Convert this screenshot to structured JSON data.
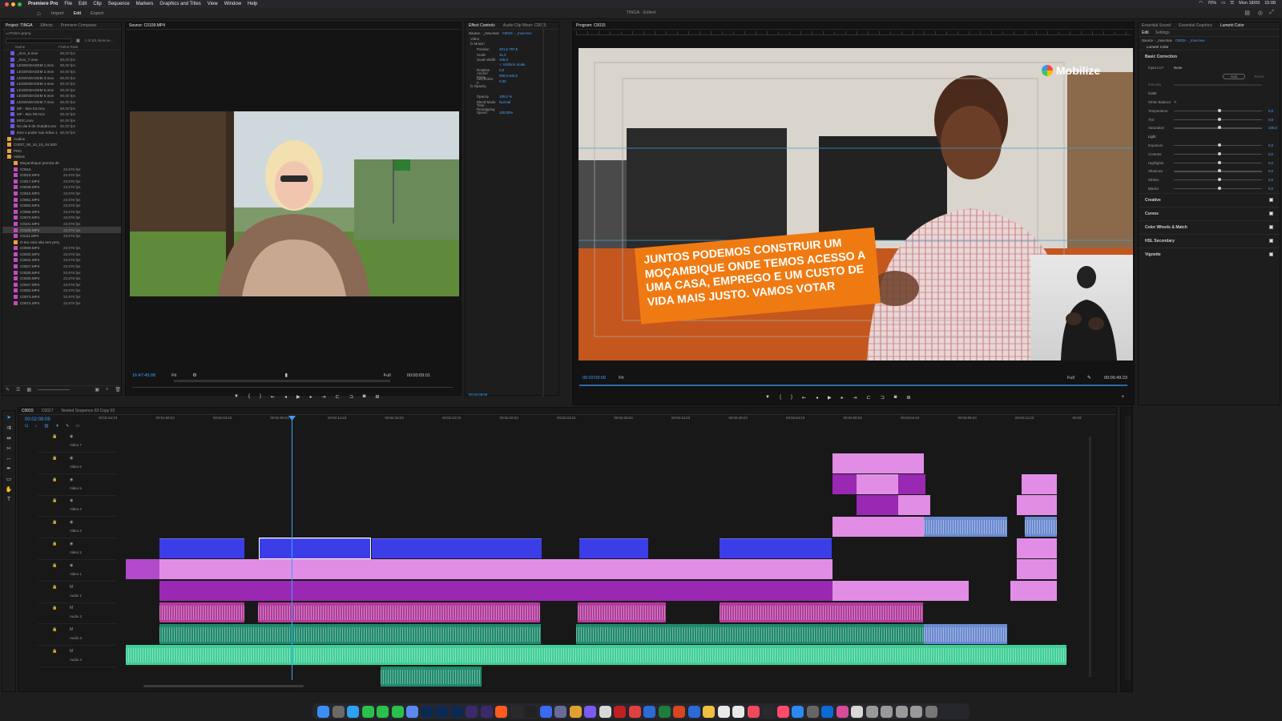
{
  "menubar": {
    "app": "Premiere Pro",
    "items": [
      "File",
      "Edit",
      "Clip",
      "Sequence",
      "Markers",
      "Graphics and Titles",
      "View",
      "Window",
      "Help"
    ],
    "right_status": [
      "70%",
      "Mon 18/09",
      "15:08"
    ]
  },
  "workspace": {
    "tabs": [
      "Import",
      "Edit",
      "Export"
    ],
    "active": "Edit",
    "title": "TINGA - Edited"
  },
  "project": {
    "tabs": [
      "Project: TINGA",
      "Effects",
      "Premiere Composer"
    ],
    "file": "TINGA.prproj",
    "count": "1 of 101 items se...",
    "columns": [
      "Name",
      "Frame Rate"
    ],
    "items": [
      {
        "name": "_mov_6.mov",
        "rate": "60,00 fps",
        "color": "#6b58e0"
      },
      {
        "name": "_mov_7.mov",
        "rate": "60,00 fps",
        "color": "#6b58e0"
      },
      {
        "name": "LEGENDAGEM 1.mov",
        "rate": "60,00 fps",
        "color": "#6b58e0"
      },
      {
        "name": "LEGENDAGEM 2.mov",
        "rate": "60,00 fps",
        "color": "#6b58e0"
      },
      {
        "name": "LEGENDAGEM 3.mov",
        "rate": "60,00 fps",
        "color": "#6b58e0"
      },
      {
        "name": "LEGENDAGEM 4.mov",
        "rate": "60,00 fps",
        "color": "#6b58e0"
      },
      {
        "name": "LEGENDAGEM 5.mov",
        "rate": "60,00 fps",
        "color": "#6b58e0"
      },
      {
        "name": "LEGENDAGEM 6.mov",
        "rate": "60,00 fps",
        "color": "#6b58e0"
      },
      {
        "name": "LEGENDAGEM 7.mov",
        "rate": "60,00 fps",
        "color": "#6b58e0"
      },
      {
        "name": "MF - Box 04.mov",
        "rate": "60,00 fps",
        "color": "#6b58e0"
      },
      {
        "name": "MF - Box 09.mov",
        "rate": "60,00 fps",
        "color": "#6b58e0"
      },
      {
        "name": "MOC.mov",
        "rate": "60,00 fps",
        "color": "#6b58e0"
      },
      {
        "name": "No dia 9 de Outubro.mo",
        "rate": "60,00 fps",
        "color": "#6b58e0"
      },
      {
        "name": "tens o poder nas mãos 1",
        "rate": "60,00 fps",
        "color": "#6b58e0"
      },
      {
        "name": "Audios",
        "rate": "",
        "color": "#e8a23a"
      },
      {
        "name": "C0037_00_10_15_04.S0093",
        "rate": "",
        "color": "#e8a23a"
      },
      {
        "name": "PNG",
        "rate": "",
        "color": "#e8a23a"
      },
      {
        "name": "Videos",
        "rate": "",
        "color": "#e8a23a"
      },
      {
        "name": "Moçambique precisa de",
        "rate": "",
        "color": "#e8a23a"
      },
      {
        "name": "C0016",
        "rate": "23,976 fps",
        "color": "#c44bc0"
      },
      {
        "name": "C0015.MP4",
        "rate": "23,976 fps",
        "color": "#c44bc0"
      },
      {
        "name": "C0017.MP4",
        "rate": "23,976 fps",
        "color": "#c44bc0"
      },
      {
        "name": "C0049.MP4",
        "rate": "23,976 fps",
        "color": "#c44bc0"
      },
      {
        "name": "C0016.MP4",
        "rate": "23,976 fps",
        "color": "#c44bc0"
      },
      {
        "name": "C0061.MP4",
        "rate": "23,976 fps",
        "color": "#c44bc0"
      },
      {
        "name": "C0063.MP4",
        "rate": "23,976 fps",
        "color": "#c44bc0"
      },
      {
        "name": "C0065.MP4",
        "rate": "23,976 fps",
        "color": "#c44bc0"
      },
      {
        "name": "C0070.MP4",
        "rate": "23,976 fps",
        "color": "#c44bc0"
      },
      {
        "name": "C0101.MP4",
        "rate": "23,976 fps",
        "color": "#c44bc0"
      },
      {
        "name": "C0109.MP4",
        "rate": "23,976 fps",
        "color": "#c44bc0",
        "selected": true
      },
      {
        "name": "C0111.MP4",
        "rate": "23,976 fps",
        "color": "#c44bc0"
      },
      {
        "name": "O teu voto não tem preç",
        "rate": "",
        "color": "#e8a23a"
      },
      {
        "name": "C0009.MP4",
        "rate": "23,976 fps",
        "color": "#c44bc0"
      },
      {
        "name": "C0020.MP4",
        "rate": "23,976 fps",
        "color": "#c44bc0"
      },
      {
        "name": "C0024.MP4",
        "rate": "23,976 fps",
        "color": "#c44bc0"
      },
      {
        "name": "C0027.MP4",
        "rate": "23,976 fps",
        "color": "#c44bc0"
      },
      {
        "name": "C0030.MP4",
        "rate": "23,976 fps",
        "color": "#c44bc0"
      },
      {
        "name": "C0035.MP4",
        "rate": "23,976 fps",
        "color": "#c44bc0"
      },
      {
        "name": "C0047.MP4",
        "rate": "23,976 fps",
        "color": "#c44bc0"
      },
      {
        "name": "C0053.MP4",
        "rate": "23,976 fps",
        "color": "#c44bc0"
      },
      {
        "name": "C0073.MP4",
        "rate": "23,976 fps",
        "color": "#c44bc0"
      },
      {
        "name": "C0074.MP4",
        "rate": "23,976 fps",
        "color": "#c44bc0"
      }
    ]
  },
  "source": {
    "tab": "Source: C0109.MP4",
    "timecode": "16:47:45:08",
    "fit": "Fit",
    "quality": "Full",
    "duration": "00:00:09:01"
  },
  "effects": {
    "tabs": [
      "Effect Controls",
      "Audio Clip Mixer: C0015"
    ],
    "source": "Source - _mov.mov",
    "clip": "C0015 - _mov.mov",
    "rows": [
      {
        "label": "Video",
        "value": ""
      },
      {
        "label": "fx Motion",
        "value": ""
      },
      {
        "label": "Position",
        "value": "401,5   797,5"
      },
      {
        "label": "Scale",
        "value": "41,0"
      },
      {
        "label": "Scale Width",
        "value": "100,0"
      },
      {
        "label": "",
        "value": "✓ Uniform Scale"
      },
      {
        "label": "Rotation",
        "value": "0,0"
      },
      {
        "label": "Anchor Point",
        "value": "960,0   540,0"
      },
      {
        "label": "Anti-flicker F.",
        "value": "0,00"
      },
      {
        "label": "fx Opacity",
        "value": ""
      },
      {
        "label": "",
        "value": ""
      },
      {
        "label": "Opacity",
        "value": "100,0 %"
      },
      {
        "label": "Blend Mode",
        "value": "Normal"
      },
      {
        "label": "Time Remapping",
        "value": ""
      },
      {
        "label": "Speed",
        "value": "100,00%"
      }
    ],
    "timecode": "00:02:09:09"
  },
  "program": {
    "tab": "Program: C0015",
    "timecode": "00:02:09:09",
    "fit": "Fit",
    "quality": "Full",
    "duration": "00:00:49:23",
    "brand": "Mobilize",
    "lower_third": "JUNTOS PODEMOS CONSTRUIR UM MOÇAMBIQUE ONDE TEMOS ACESSO A UMA CASA, EMPREGO E UM CUSTO DE VIDA MAIS JUSTO. VAMOS VOTAR"
  },
  "lumetri": {
    "tabs": [
      "Essential Sound",
      "Essential Graphics",
      "Lumetri Color"
    ],
    "subtabs": [
      "Edit",
      "Settings"
    ],
    "source": "Source - _mov.mov",
    "clip": "C0015 - _mov.mov",
    "effect": "Lumetri Color",
    "basic": "Basic Correction",
    "input_lut_label": "Input LUT",
    "input_lut": "None",
    "auto": "Auto",
    "reset": "Reset",
    "intensity": "Intensity",
    "color_label": "Color",
    "white_balance": "White Balance",
    "color_sliders": [
      {
        "label": "Temperature",
        "value": "0,0",
        "pos": 0.5
      },
      {
        "label": "Tint",
        "value": "0,0",
        "pos": 0.5
      },
      {
        "label": "Saturation",
        "value": "100,0",
        "pos": 0.5
      }
    ],
    "light_label": "Light",
    "light_sliders": [
      {
        "label": "Exposure",
        "value": "0,0",
        "pos": 0.5
      },
      {
        "label": "Contrast",
        "value": "0,0",
        "pos": 0.5
      },
      {
        "label": "Highlights",
        "value": "0,0",
        "pos": 0.5
      },
      {
        "label": "Shadows",
        "value": "0,0",
        "pos": 0.5
      },
      {
        "label": "Whites",
        "value": "0,0",
        "pos": 0.5
      },
      {
        "label": "Blacks",
        "value": "0,0",
        "pos": 0.5
      }
    ],
    "sections": [
      "Creative",
      "Curves",
      "Color Wheels & Match",
      "HSL Secondary",
      "Vignette"
    ]
  },
  "timeline": {
    "tabs": [
      "C0015",
      "C0027",
      "Nested Sequence 03 Copy 03"
    ],
    "timecode": "00:02:09:09",
    "ruler": [
      "00:01:54:23",
      "00:01:59:23",
      "00:02:04:23",
      "00:02:09:23",
      "00:02:14:23",
      "00:02:19:23",
      "00:02:24:23",
      "00:02:29:23",
      "00:02:34:23",
      "00:02:39:23",
      "00:02:44:23",
      "00:02:49:23",
      "00:02:54:23",
      "00:02:59:23",
      "00:03:04:23",
      "00:03:09:23",
      "00:03:14:23",
      "00:03"
    ],
    "tracks": [
      "Video 7",
      "Video 6",
      "Video 5",
      "Video 4",
      "Video 3",
      "Video 2",
      "Video 1",
      "Audio 1",
      "Audio 2",
      "Audio 3",
      "Audio 4"
    ]
  },
  "colors": {
    "accent": "#3aa0ff",
    "video_blue": "#3b3ee6",
    "video_pink": "#e18de6",
    "video_purple": "#9a28b3",
    "audio_green": "#1f8a6c",
    "audio_mint": "#3fcf96",
    "lower_third": "#f07a12"
  }
}
